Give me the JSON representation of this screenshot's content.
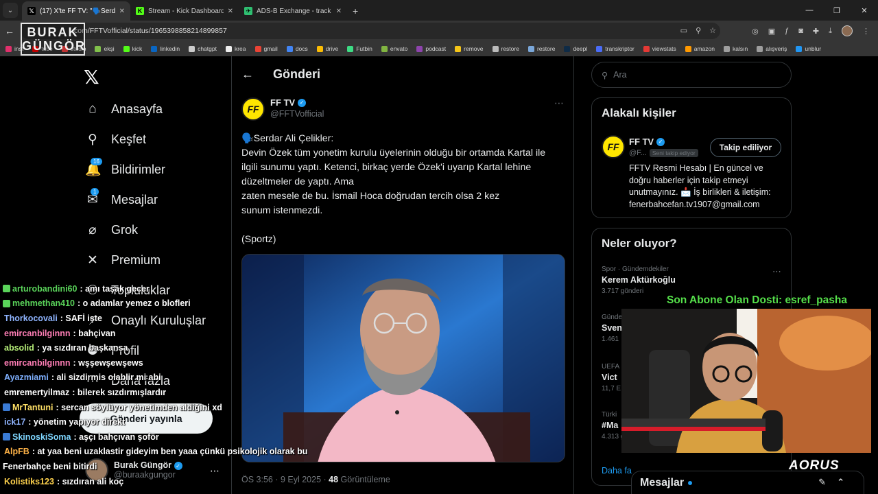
{
  "browser": {
    "tabs": [
      {
        "title": "(17) X'te FF TV: \"🗣️Serdar Ali Ç",
        "active": true,
        "icon_color": "#000000",
        "icon_glyph": "𝕏"
      },
      {
        "title": "Stream - Kick Dashboard",
        "active": false,
        "icon_color": "#53fc18",
        "icon_glyph": "K"
      },
      {
        "title": "ADS-B Exchange - track aircraft",
        "active": false,
        "icon_color": "#2fbf71",
        "icon_glyph": "✈"
      }
    ],
    "url": "com/FFTVofficial/status/1965398858214899857",
    "bookmarks": [
      {
        "label": "inst",
        "color": "#e1306c"
      },
      {
        "label": "tube",
        "color": "#ff0000"
      },
      {
        "label": "studio",
        "color": "#ff4444"
      },
      {
        "label": "ekşi",
        "color": "#81c14b"
      },
      {
        "label": "kick",
        "color": "#53fc18"
      },
      {
        "label": "linkedin",
        "color": "#0a66c2"
      },
      {
        "label": "chatgpt",
        "color": "#cccccc"
      },
      {
        "label": "krea",
        "color": "#eeeeee"
      },
      {
        "label": "gmail",
        "color": "#ea4335"
      },
      {
        "label": "docs",
        "color": "#4285f4"
      },
      {
        "label": "drive",
        "color": "#fbbc04"
      },
      {
        "label": "Futbin",
        "color": "#3ddc84"
      },
      {
        "label": "envato",
        "color": "#81b441"
      },
      {
        "label": "podcast",
        "color": "#8e44ad"
      },
      {
        "label": "remove",
        "color": "#f5c518"
      },
      {
        "label": "restore",
        "color": "#bbbbbb"
      },
      {
        "label": "restore",
        "color": "#7aa7d9"
      },
      {
        "label": "deepl",
        "color": "#0f2b46"
      },
      {
        "label": "transkriptor",
        "color": "#4a6cf7"
      },
      {
        "label": "viewstats",
        "color": "#e53935"
      },
      {
        "label": "amazon",
        "color": "#ff9900"
      },
      {
        "label": "kalsın",
        "color": "#9e9e9e"
      },
      {
        "label": "alışveriş",
        "color": "#9e9e9e"
      },
      {
        "label": "unblur",
        "color": "#2196f3"
      }
    ]
  },
  "overlay_logo": {
    "line1": "BURAK",
    "line2": "GÜNGÖR"
  },
  "sidebar": {
    "items": [
      {
        "label": "Anasayfa",
        "icon": "home-icon",
        "glyph": "⌂"
      },
      {
        "label": "Keşfet",
        "icon": "search-icon",
        "glyph": "⚲"
      },
      {
        "label": "Bildirimler",
        "icon": "bell-icon",
        "glyph": "🔔",
        "badge": "16"
      },
      {
        "label": "Mesajlar",
        "icon": "mail-icon",
        "glyph": "✉",
        "badge": "1"
      },
      {
        "label": "Grok",
        "icon": "grok-icon",
        "glyph": "⌀"
      },
      {
        "label": "Premium",
        "icon": "x-icon",
        "glyph": "✕"
      },
      {
        "label": "Topluluklar",
        "icon": "people-icon",
        "glyph": "⚇"
      },
      {
        "label": "Onaylı Kuruluşlar",
        "icon": "lightning-icon",
        "glyph": "⚡"
      },
      {
        "label": "Profil",
        "icon": "person-icon",
        "glyph": "⚉"
      },
      {
        "label": "Daha fazla",
        "icon": "more-icon",
        "glyph": "⋯"
      }
    ],
    "post_button": "Gönderi yayınla",
    "user": {
      "name": "Burak Güngör",
      "handle": "@buraakgungor"
    }
  },
  "post": {
    "header_title": "Gönderi",
    "author_name": "FF TV",
    "author_handle": "@FFTVofficial",
    "avatar_text": "FF",
    "lines": [
      "🗣️Serdar Ali Çelikler:",
      "Devin Özek tüm yonetim kurulu üyelerinin olduğu bir ortamda Kartal ile",
      "ilgili sunumu yaptı. Ketenci, birkaç yerde Özek'i uyarıp Kartal lehine",
      "düzeltmeler de yaptı. Ama",
      "zaten mesele de bu. İsmail Hoca doğrudan tercih olsa 2 kez",
      "sunum istenmezdi."
    ],
    "source": "(Sportz)",
    "time": "ÖS 3:56 · 9 Eyl 2025 · ",
    "views": "48",
    "views_label": " Görüntüleme"
  },
  "right": {
    "search_placeholder": "Ara",
    "related_title": "Alakalı kişiler",
    "related": {
      "name": "FF TV",
      "handle": "@F...",
      "follows_you": "Seni takip ediyor",
      "follow_button": "Takip ediliyor",
      "bio_lines": [
        "FFTV Resmi Hesabı | En güncel ve",
        "doğru haberler için takip etmeyi",
        "unutmayınız. 📩 İş birlikleri & iletişim:",
        "fenerbahcefan.tv1907@gmail.com"
      ]
    },
    "trends_title": "Neler oluyor?",
    "trends": [
      {
        "meta": "Spor · Gündemdekiler",
        "name": "Kerem Aktürkoğlu",
        "count": "3.717 gönderi"
      },
      {
        "meta": "Günde",
        "name": "Sven",
        "count": "1.461"
      },
      {
        "meta": "UEFA",
        "name": "Vict",
        "count": "11,7 E"
      },
      {
        "meta": "Türki",
        "name": "#Ma",
        "count": "4.313 g"
      }
    ],
    "show_more": "Daha fa",
    "messages_label": "Mesajlar"
  },
  "stream": {
    "sub_label": "Son Abone Olan Dosti: esref_pasha",
    "brand": "AORUS",
    "chat": [
      {
        "user": "arturobandini60",
        "msg": " : amı taşak gecer",
        "color": "#5ad45a",
        "badge": "#5ad45a"
      },
      {
        "user": "mehmethan410",
        "msg": " : o adamlar yemez o blofleri",
        "color": "#5ad45a",
        "badge": "#5ad45a"
      },
      {
        "user": "Thorkocovali",
        "msg": " : SAFİ işte",
        "color": "#8fb4ff"
      },
      {
        "user": "emircanbilginnn",
        "msg": " : bahçivan",
        "color": "#ff7eb6"
      },
      {
        "user": "absolid",
        "msg": " : ya sızdıran başkansa",
        "color": "#b7f07a"
      },
      {
        "user": "emircanbilginnn",
        "msg": " : wşşewşewşews",
        "color": "#ff7eb6"
      },
      {
        "user": "Ayazmiami",
        "msg": " : ali sizdirmis olablir mi abi",
        "color": "#7fb0ff"
      },
      {
        "user": "emremertyilmaz",
        "msg": " : bilerek sızdırmışlardır",
        "color": "#ffffff"
      },
      {
        "user": "MrTantuni",
        "msg": " : sercan söylüyor yönetimden aldiğini xd",
        "color": "#ffe066",
        "badge": "#3a7bd5"
      },
      {
        "user": "ick17",
        "msg": " : yönetim yapıyor direkt",
        "color": "#8fb4ff"
      },
      {
        "user": "SkinoskiSoma",
        "msg": " : aşçı bahçıvan şoför",
        "color": "#7fd6ff",
        "badge": "#3a7bd5"
      },
      {
        "user": "AlpFB",
        "msg": " : at yaa beni uzaklastir gideyim ben yaaa çünkü psikolojik olarak bu",
        "color": "#ffb347"
      }
    ],
    "chat_continued": "Fenerbahçe beni bitirdi",
    "chat_last": {
      "user": "Kolistiks123",
      "msg": " : sızdıran ali koç",
      "color": "#ffd24d"
    }
  }
}
